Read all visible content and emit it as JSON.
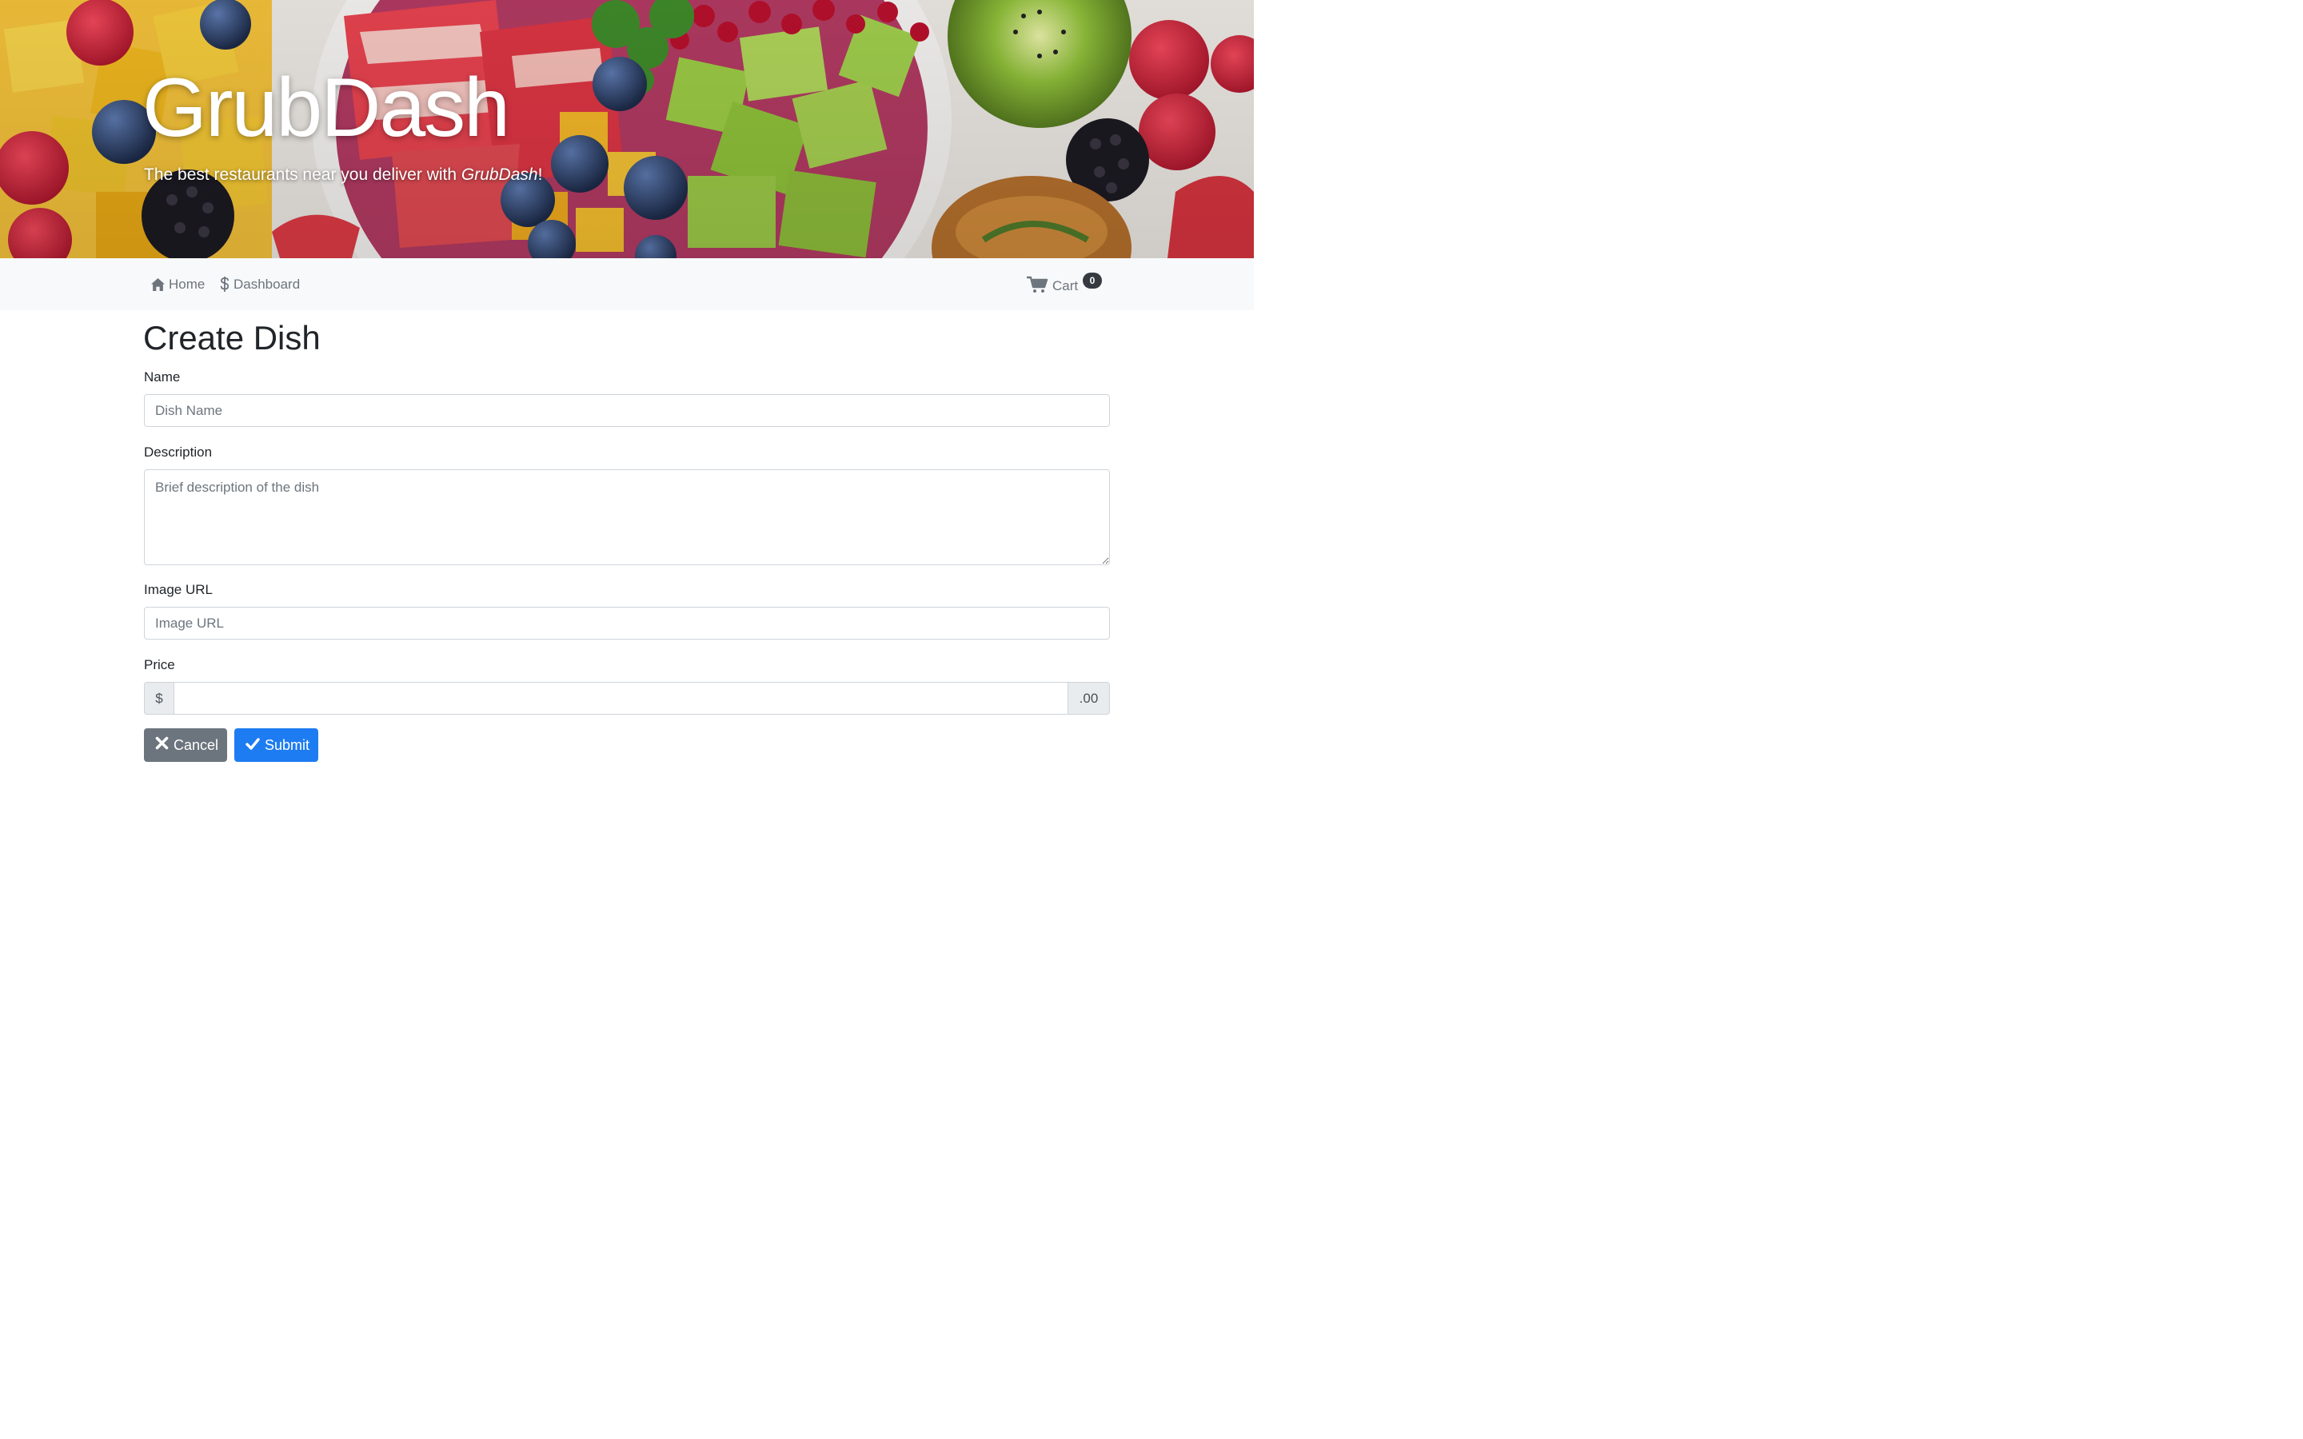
{
  "hero": {
    "title": "GrubDash",
    "subtitle_prefix": "The best restaurants near you deliver with ",
    "subtitle_brand": "GrubDash",
    "subtitle_suffix": "!"
  },
  "nav": {
    "items": [
      {
        "label": "Home",
        "icon": "home-icon"
      },
      {
        "label": "Dashboard",
        "icon": "dollar-icon"
      }
    ],
    "cart": {
      "label": "Cart",
      "icon": "cart-icon",
      "count": "0"
    }
  },
  "form": {
    "title": "Create Dish",
    "name": {
      "label": "Name",
      "placeholder": "Dish Name",
      "value": ""
    },
    "description": {
      "label": "Description",
      "placeholder": "Brief description of the dish",
      "value": ""
    },
    "image_url": {
      "label": "Image URL",
      "placeholder": "Image URL",
      "value": ""
    },
    "price": {
      "label": "Price",
      "prefix": "$",
      "suffix": ".00",
      "value": ""
    },
    "cancel_label": "Cancel",
    "submit_label": "Submit"
  },
  "colors": {
    "primary": "#1e7cf2",
    "secondary": "#6c757d",
    "navbar_bg": "#f8f9fa",
    "badge_bg": "#343a40"
  }
}
